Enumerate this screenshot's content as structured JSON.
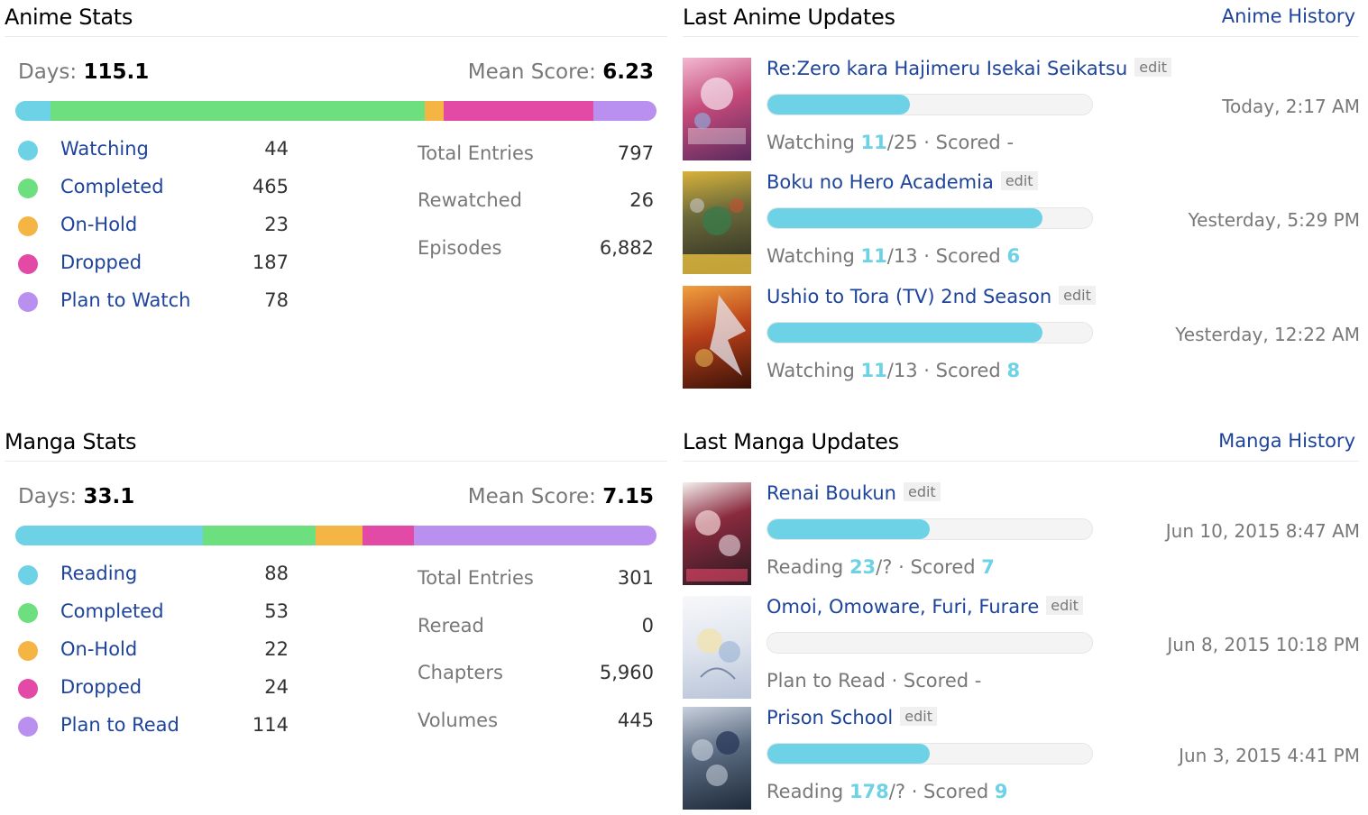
{
  "colors": {
    "watching": "#6dd2e5",
    "completed": "#6ddf7e",
    "on_hold": "#f4b545",
    "dropped": "#e34aa6",
    "plan": "#b98ff0",
    "link": "#1d439b",
    "progress": "#6dd2e5"
  },
  "anime_stats": {
    "title": "Anime Stats",
    "days_label": "Days:",
    "days_value": "115.1",
    "mean_label": "Mean Score:",
    "mean_value": "6.23",
    "bar": [
      {
        "status": "Watching",
        "count": 44,
        "color": "#6dd2e5"
      },
      {
        "status": "Completed",
        "count": 465,
        "color": "#6ddf7e"
      },
      {
        "status": "On-Hold",
        "count": 23,
        "color": "#f4b545"
      },
      {
        "status": "Dropped",
        "count": 187,
        "color": "#e34aa6"
      },
      {
        "status": "Plan to Watch",
        "count": 78,
        "color": "#b98ff0"
      }
    ],
    "statuses": [
      {
        "label": "Watching",
        "count": "44"
      },
      {
        "label": "Completed",
        "count": "465"
      },
      {
        "label": "On-Hold",
        "count": "23"
      },
      {
        "label": "Dropped",
        "count": "187"
      },
      {
        "label": "Plan to Watch",
        "count": "78"
      }
    ],
    "totals": [
      {
        "label": "Total Entries",
        "value": "797"
      },
      {
        "label": "Rewatched",
        "value": "26"
      },
      {
        "label": "Episodes",
        "value": "6,882"
      }
    ]
  },
  "manga_stats": {
    "title": "Manga Stats",
    "days_label": "Days:",
    "days_value": "33.1",
    "mean_label": "Mean Score:",
    "mean_value": "7.15",
    "bar": [
      {
        "status": "Reading",
        "count": 88,
        "color": "#6dd2e5"
      },
      {
        "status": "Completed",
        "count": 53,
        "color": "#6ddf7e"
      },
      {
        "status": "On-Hold",
        "count": 22,
        "color": "#f4b545"
      },
      {
        "status": "Dropped",
        "count": 24,
        "color": "#e34aa6"
      },
      {
        "status": "Plan to Read",
        "count": 114,
        "color": "#b98ff0"
      }
    ],
    "statuses": [
      {
        "label": "Reading",
        "count": "88"
      },
      {
        "label": "Completed",
        "count": "53"
      },
      {
        "label": "On-Hold",
        "count": "22"
      },
      {
        "label": "Dropped",
        "count": "24"
      },
      {
        "label": "Plan to Read",
        "count": "114"
      }
    ],
    "totals": [
      {
        "label": "Total Entries",
        "value": "301"
      },
      {
        "label": "Reread",
        "value": "0"
      },
      {
        "label": "Chapters",
        "value": "5,960"
      },
      {
        "label": "Volumes",
        "value": "445"
      }
    ]
  },
  "anime_updates": {
    "title": "Last Anime Updates",
    "history_link": "Anime History",
    "items": [
      {
        "title": "Re:Zero kara Hajimeru Isekai Seikatsu",
        "edit": "edit",
        "progress": 0.44,
        "status": "Watching",
        "current": "11",
        "total": "/25",
        "scored_label": "· Scored",
        "score": "-",
        "time": "Today, 2:17 AM",
        "cover": "#c44a7a"
      },
      {
        "title": "Boku no Hero Academia",
        "edit": "edit",
        "progress": 0.846,
        "status": "Watching",
        "current": "11",
        "total": "/13",
        "scored_label": "· Scored",
        "score": "6",
        "time": "Yesterday, 5:29 PM",
        "cover": "#3b3a2c"
      },
      {
        "title": "Ushio to Tora (TV) 2nd Season",
        "edit": "edit",
        "progress": 0.846,
        "status": "Watching",
        "current": "11",
        "total": "/13",
        "scored_label": "· Scored",
        "score": "8",
        "time": "Yesterday, 12:22 AM",
        "cover": "#b8401a"
      }
    ]
  },
  "manga_updates": {
    "title": "Last Manga Updates",
    "history_link": "Manga History",
    "items": [
      {
        "title": "Renai Boukun",
        "edit": "edit",
        "progress": 0.5,
        "status": "Reading",
        "current": "23",
        "total": "/?",
        "scored_label": "· Scored",
        "score": "7",
        "time": "Jun 10, 2015 8:47 AM",
        "cover": "#6b2a3a"
      },
      {
        "title": "Omoi, Omoware, Furi, Furare",
        "edit": "edit",
        "progress": 0.0,
        "status": "Plan to Read",
        "current": "",
        "total": "",
        "scored_label": "· Scored",
        "score": "-",
        "time": "Jun 8, 2015 10:18 PM",
        "cover": "#d8dde8"
      },
      {
        "title": "Prison School",
        "edit": "edit",
        "progress": 0.5,
        "status": "Reading",
        "current": "178",
        "total": "/?",
        "scored_label": "· Scored",
        "score": "9",
        "time": "Jun 3, 2015 4:41 PM",
        "cover": "#5a6a80"
      }
    ]
  }
}
